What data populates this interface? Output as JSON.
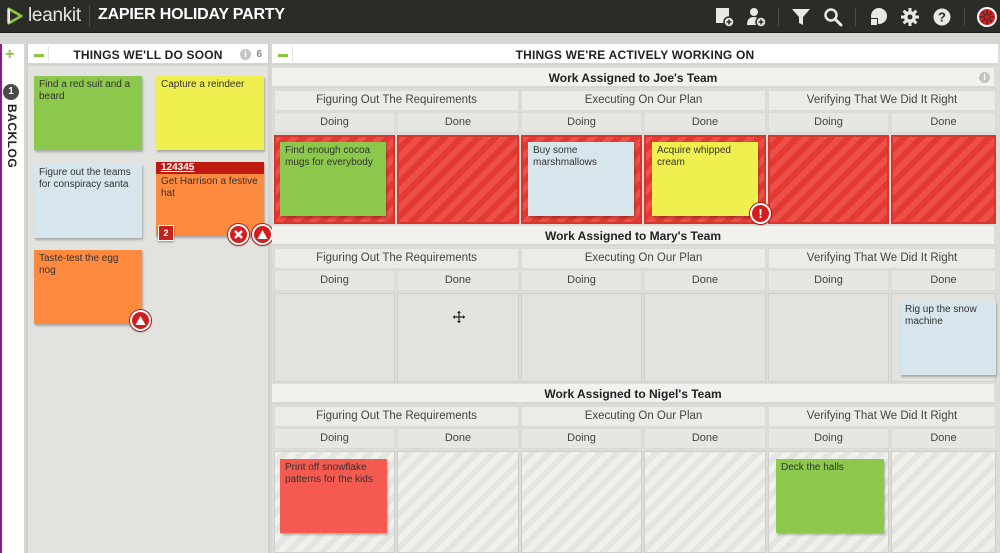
{
  "app": {
    "brand": "leankit",
    "board_title": "ZAPIER HOLIDAY PARTY",
    "toolbar_icons": [
      "add-card-icon",
      "add-user-icon",
      "filter-icon",
      "search-icon",
      "pie-chart-icon",
      "gear-icon",
      "help-icon",
      "avatar-icon"
    ],
    "colors": {
      "topbar": "#2b2c28",
      "accent_green": "#8cc63f",
      "blocked_red": "#e23a32"
    }
  },
  "backlog": {
    "label": "BACKLOG",
    "count": "1",
    "add_label": "+"
  },
  "soon_lane": {
    "title": "THINGS WE'LL DO SOON",
    "info": "i",
    "wip": "6",
    "cards": [
      {
        "text": "Find a red suit and a beard",
        "color": "green"
      },
      {
        "text": "Capture a reindeer",
        "color": "yellow"
      },
      {
        "text": "Figure out the teams for conspiracy santa",
        "color": "blue"
      },
      {
        "id": "124345",
        "text": "Get Harrison a festive hat",
        "color": "orange",
        "badge": "2",
        "actions": [
          "blocked-x",
          "priority-up"
        ]
      },
      {
        "text": "Taste-test the egg nog",
        "color": "orange",
        "actions": [
          "priority-up"
        ]
      }
    ]
  },
  "active_lane": {
    "title": "THINGS WE'RE ACTIVELY WORKING ON",
    "phases": [
      "Figuring Out The Requirements",
      "Executing On Our Plan",
      "Verifying That We Did It Right"
    ],
    "subcolumns": [
      "Doing",
      "Done"
    ],
    "teams": [
      {
        "name": "Work Assigned to Joe's Team",
        "info": "i",
        "cards": [
          {
            "text": "Find enough cocoa mugs for everybody",
            "color": "green"
          },
          {
            "text": "Buy some marshmallows",
            "color": "blue"
          },
          {
            "text": "Acquire whipped cream",
            "color": "yellow",
            "alert": "!"
          }
        ]
      },
      {
        "name": "Work Assigned to Mary's Team",
        "cards": [
          {
            "text": "Rig up the snow machine",
            "color": "blue"
          }
        ]
      },
      {
        "name": "Work Assigned to Nigel's Team",
        "cards": [
          {
            "text": "Print off snowflake patterns for the kids",
            "color": "red"
          },
          {
            "text": "Deck the halls",
            "color": "green"
          }
        ]
      }
    ]
  }
}
